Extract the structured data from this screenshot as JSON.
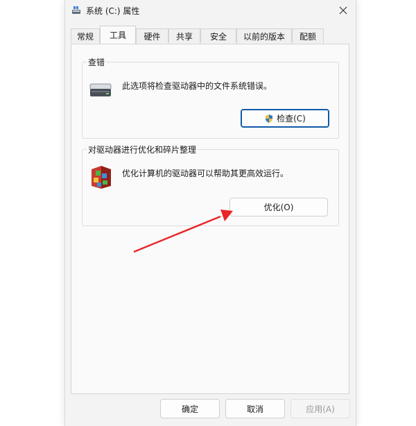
{
  "window": {
    "title": "系统 (C:) 属性",
    "icons": {
      "app": "drive-icon",
      "close": "close-icon"
    }
  },
  "tabs": [
    {
      "label": "常规"
    },
    {
      "label": "工具",
      "active": true
    },
    {
      "label": "硬件"
    },
    {
      "label": "共享"
    },
    {
      "label": "安全"
    },
    {
      "label": "以前的版本"
    },
    {
      "label": "配额"
    }
  ],
  "error_checking": {
    "title": "查错",
    "description": "此选项将检查驱动器中的文件系统错误。",
    "button_label": "检查(C)",
    "icon": "hard-drive-icon",
    "button_icon": "uac-shield-icon"
  },
  "optimize": {
    "title": "对驱动器进行优化和碎片整理",
    "description": "优化计算机的驱动器可以帮助其更高效运行。",
    "button_label": "优化(O)",
    "icon": "defrag-icon"
  },
  "footer": {
    "ok": "确定",
    "cancel": "取消",
    "apply": "应用(A)"
  },
  "annotation": {
    "color": "#e8262a",
    "target": "optimize-button"
  },
  "colors": {
    "accent_border": "#0f5aa8",
    "window_bg": "#f3f3f3",
    "panel_bg": "#fafafa"
  }
}
